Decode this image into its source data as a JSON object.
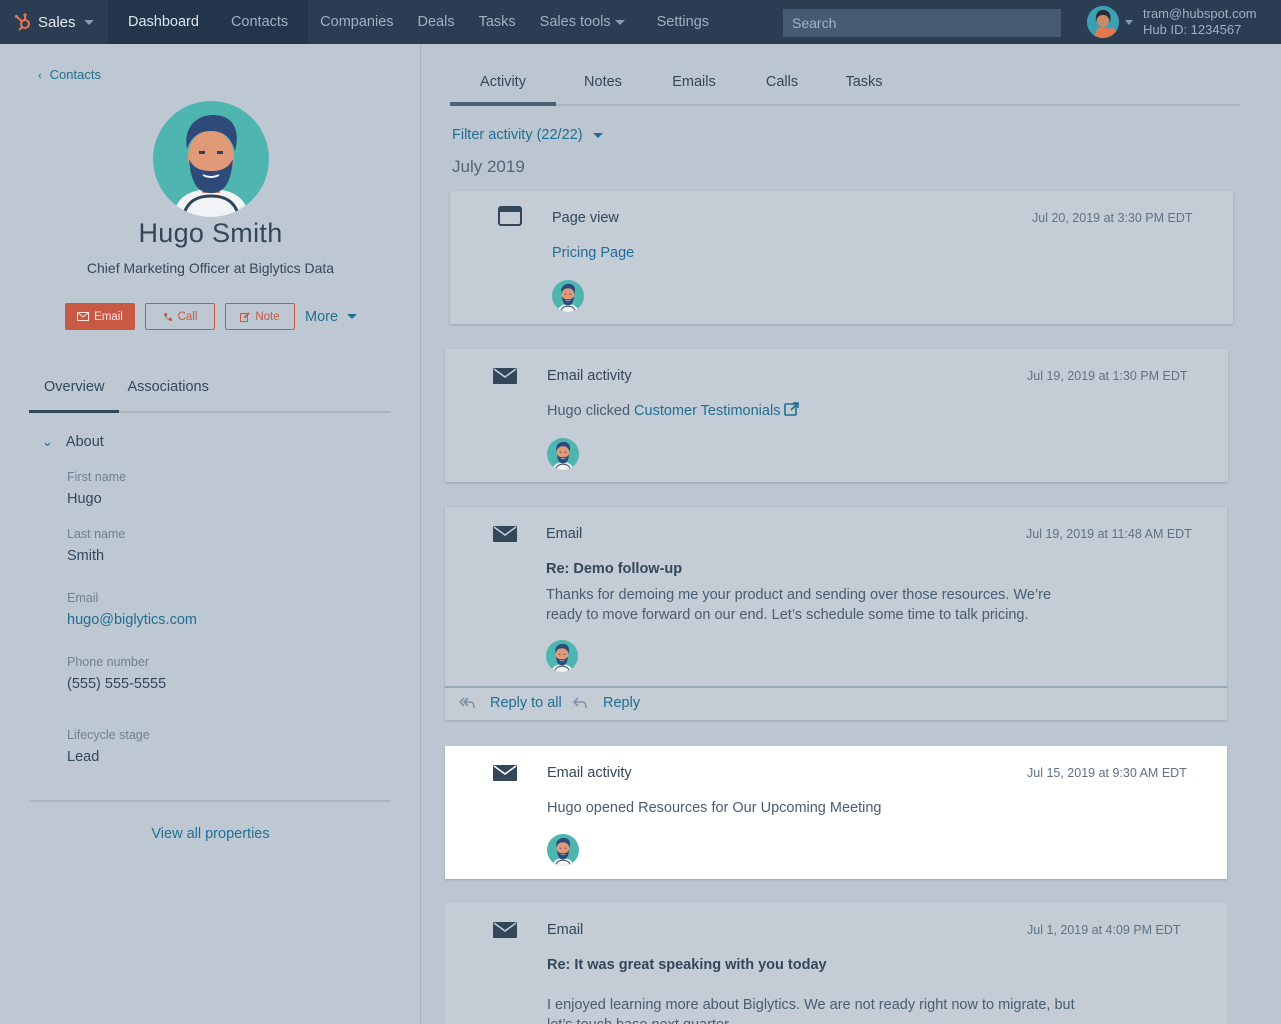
{
  "nav": {
    "brand": "Sales",
    "items": [
      {
        "label": "Dashboard"
      },
      {
        "label": "Contacts"
      },
      {
        "label": "Companies"
      },
      {
        "label": "Deals"
      },
      {
        "label": "Tasks"
      },
      {
        "label": "Sales tools"
      },
      {
        "label": "Settings"
      }
    ],
    "search_placeholder": "Search",
    "account_email": "tram@hubspot.com",
    "account_hub": "Hub ID: 1234567"
  },
  "contact": {
    "back_label": "Contacts",
    "name": "Hugo Smith",
    "title": "Chief Marketing Officer at Biglytics Data",
    "actions": {
      "email": "Email",
      "call": "Call",
      "note": "Note",
      "more": "More"
    },
    "tabs": [
      {
        "label": "Overview"
      },
      {
        "label": "Associations"
      }
    ],
    "section_title": "About",
    "properties": [
      {
        "label": "First name",
        "value": "Hugo"
      },
      {
        "label": "Last name",
        "value": "Smith"
      },
      {
        "label": "Email",
        "value": "hugo@biglytics.com"
      },
      {
        "label": "Phone number",
        "value": "(555) 555-5555"
      },
      {
        "label": "Lifecycle stage",
        "value": "Lead"
      }
    ],
    "view_all": "View all properties"
  },
  "activity": {
    "tabs": [
      {
        "label": "Activity"
      },
      {
        "label": "Notes"
      },
      {
        "label": "Emails"
      },
      {
        "label": "Calls"
      },
      {
        "label": "Tasks"
      }
    ],
    "filter": "Filter activity (22/22)",
    "month": "July 2019",
    "cards": [
      {
        "type": "Page view",
        "time": "Jul 20, 2019 at 3:30 PM EDT",
        "link": "Pricing Page"
      },
      {
        "type": "Email activity",
        "time": "Jul 19, 2019 at 1:30 PM EDT",
        "prefix": "Hugo clicked ",
        "link": "Customer Testimonials"
      },
      {
        "type": "Email",
        "time": "Jul 19, 2019 at 11:48 AM EDT",
        "subject": "Re: Demo follow-up",
        "body_line1": "Thanks for demoing me your product and sending over those resources. We’re",
        "body_line2": "ready to move forward on our end. Let’s schedule some time to talk pricing."
      },
      {
        "type": "Email activity",
        "time": "Jul 15, 2019 at 9:30 AM EDT",
        "text": "Hugo opened Resources for Our Upcoming Meeting"
      },
      {
        "type": "Email",
        "time": "Jul 1, 2019 at 4:09 PM EDT",
        "subject": "Re: It was great speaking with you today",
        "body_line1": "I enjoyed learning more about Biglytics. We are not ready right now to migrate, but",
        "body_line2": "let’s touch base next quarter."
      }
    ],
    "reply_all": "Reply to all",
    "reply": "Reply"
  },
  "colors": {
    "nav_bg": "#2a3d52",
    "accent_link": "#1f6e93",
    "action_orange": "#c85a45",
    "white_card": "#ffffff"
  }
}
